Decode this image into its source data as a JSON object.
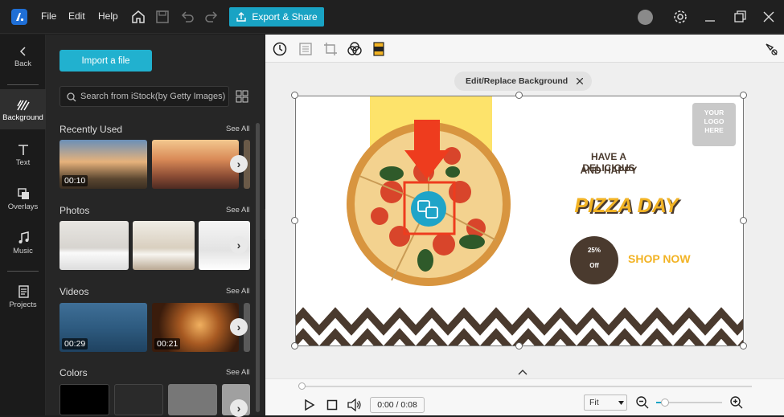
{
  "menu": {
    "file": "File",
    "edit": "Edit",
    "help": "Help"
  },
  "export_label": "Export & Share",
  "nav": {
    "back": "Back",
    "background": "Background",
    "text": "Text",
    "overlays": "Overlays",
    "music": "Music",
    "projects": "Projects"
  },
  "panel": {
    "import_label": "Import a file",
    "search_placeholder": "Search from iStock(by Getty Images)",
    "see_all": "See All",
    "sections": {
      "recent": {
        "title": "Recently Used",
        "durations": [
          "00:10"
        ]
      },
      "photos": {
        "title": "Photos"
      },
      "videos": {
        "title": "Videos",
        "durations": [
          "00:29",
          "00:21"
        ]
      },
      "colors": {
        "title": "Colors"
      }
    }
  },
  "editor": {
    "pill_label": "Edit/Replace Background",
    "canvas": {
      "logo": "YOUR\nLOGO\nHERE",
      "headline1": "HAVE A DELICIOUS",
      "headline2": "AND HAPPY",
      "pizza_day": "PIZZA DAY",
      "discount1": "25%",
      "discount2": "Off",
      "shop_now": "SHOP NOW"
    },
    "timecode": "0:00 / 0:08",
    "zoom_mode": "Fit",
    "playhead_fraction": 0
  },
  "colors": {
    "accent": "#19a3c4",
    "canvas_yellow": "#fde36b",
    "brown": "#4a3a2e",
    "orange": "#f2b324",
    "arrow": "#ee3c1e"
  }
}
